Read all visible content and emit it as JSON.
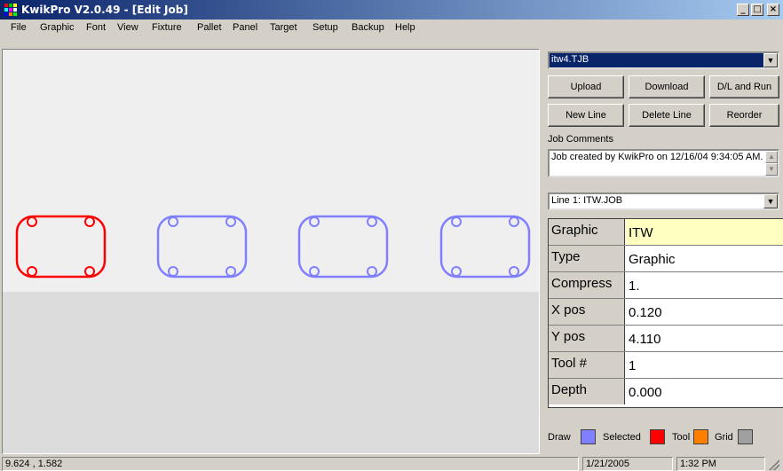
{
  "window": {
    "title": "KwikPro  V2.0.49 - [Edit Job]",
    "controls": [
      "_",
      "□",
      "×"
    ]
  },
  "menu": [
    "File",
    "Graphic",
    "Font",
    "View",
    "Fixture",
    "Pallet",
    "Panel",
    "Target",
    "Setup",
    "Backup",
    "Help"
  ],
  "file_combo": {
    "value": "itw4.TJB"
  },
  "buttons": {
    "upload": "Upload",
    "download": "Download",
    "dl_run": "D/L and Run",
    "new_line": "New Line",
    "delete_line": "Delete Line",
    "reorder": "Reorder"
  },
  "job_comments": {
    "label": "Job Comments",
    "text": "Job created by KwikPro on 12/16/04 9:34:05 AM."
  },
  "line_combo": {
    "value": "Line 1: ITW.JOB"
  },
  "properties": [
    {
      "key": "Graphic",
      "value": "ITW"
    },
    {
      "key": "Type",
      "value": "Graphic"
    },
    {
      "key": "Compress",
      "value": "1."
    },
    {
      "key": "X pos",
      "value": "0.120"
    },
    {
      "key": "Y pos",
      "value": "4.110"
    },
    {
      "key": "Tool #",
      "value": "1"
    },
    {
      "key": "Depth",
      "value": "0.000"
    }
  ],
  "legend": {
    "draw": "Draw",
    "selected": "Selected",
    "tool": "Tool",
    "grid": "Grid"
  },
  "colors": {
    "draw": "#8080ff",
    "selected": "#ff0000",
    "tool": "#ff8000",
    "grid": "#a0a0a0",
    "highlight": "#ffffc0"
  },
  "canvas": {
    "shapes": [
      {
        "name": "graphic-1",
        "state": "selected"
      },
      {
        "name": "graphic-2",
        "state": "draw"
      },
      {
        "name": "graphic-3",
        "state": "draw"
      },
      {
        "name": "graphic-4",
        "state": "draw"
      }
    ]
  },
  "status": {
    "coords": "9.624 , 1.582",
    "date": "1/21/2005",
    "time": "1:32 PM"
  }
}
